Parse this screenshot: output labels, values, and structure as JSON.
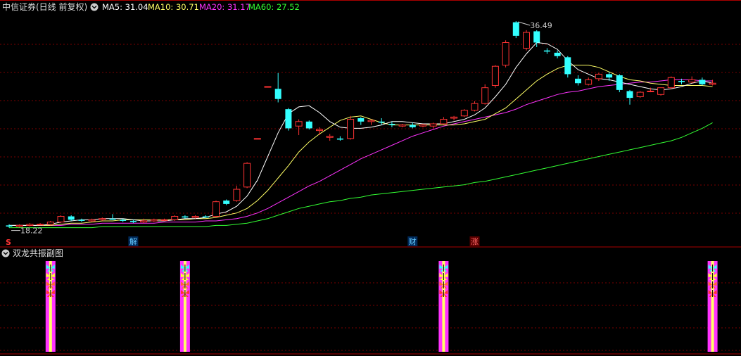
{
  "main_panel": {
    "title": "中信证券(日线 前复权)",
    "indicators": [
      {
        "label": "MA5: 31.04",
        "color": "#ffffff"
      },
      {
        "label": "MA10: 30.71",
        "color": "#ffff66"
      },
      {
        "label": "MA20: 31.17",
        "color": "#ff33ff"
      },
      {
        "label": "MA60: 27.52",
        "color": "#33ff33"
      }
    ],
    "high_label": "36.49",
    "low_label": "18.22",
    "markers": [
      {
        "text": "解",
        "index": 12,
        "kind": "tag"
      },
      {
        "text": "财",
        "index": 39,
        "kind": "tag"
      },
      {
        "text": "涨",
        "index": 45,
        "kind": "tag"
      },
      {
        "text": "S",
        "index": 0,
        "kind": "signal"
      }
    ]
  },
  "sub_panel": {
    "title": "双龙共振副图",
    "signal_indices": [
      4,
      17,
      42,
      68
    ],
    "icon": "butterfly-icon"
  },
  "colors": {
    "up": "#ff3333",
    "down": "#33ffff",
    "ma5": "#ffffff",
    "ma10": "#ffff66",
    "ma20": "#ff33ff",
    "ma60": "#33ff33",
    "grid": "#7a0000",
    "panel_border": "#aa0000",
    "signal_bar": "#ff33ff",
    "signal_core": "#ffff66"
  },
  "chart_data": {
    "type": "candlestick",
    "y_range": [
      17.8,
      37.0
    ],
    "x_count": 69,
    "ohlc": [
      [
        18.4,
        18.5,
        18.2,
        18.3
      ],
      [
        18.3,
        18.5,
        18.2,
        18.4
      ],
      [
        18.4,
        18.6,
        18.3,
        18.5
      ],
      [
        18.5,
        18.6,
        18.4,
        18.5
      ],
      [
        18.5,
        18.8,
        18.4,
        18.7
      ],
      [
        18.7,
        19.3,
        18.6,
        19.2
      ],
      [
        19.2,
        19.3,
        18.8,
        18.9
      ],
      [
        18.9,
        19.0,
        18.7,
        18.8
      ],
      [
        18.8,
        19.0,
        18.7,
        18.9
      ],
      [
        18.9,
        19.1,
        18.8,
        19.0
      ],
      [
        19.0,
        19.4,
        18.9,
        18.9
      ],
      [
        18.9,
        19.0,
        18.7,
        18.8
      ],
      [
        18.8,
        18.9,
        18.6,
        18.7
      ],
      [
        18.7,
        19.0,
        18.6,
        18.8
      ],
      [
        18.8,
        19.0,
        18.7,
        18.9
      ],
      [
        18.9,
        19.0,
        18.8,
        18.9
      ],
      [
        18.9,
        19.3,
        18.8,
        19.2
      ],
      [
        19.2,
        19.3,
        19.0,
        19.1
      ],
      [
        19.1,
        19.3,
        19.0,
        19.2
      ],
      [
        19.2,
        19.3,
        19.1,
        19.1
      ],
      [
        19.2,
        20.6,
        19.1,
        20.5
      ],
      [
        20.6,
        20.7,
        20.2,
        20.3
      ],
      [
        20.6,
        21.9,
        20.5,
        21.6
      ],
      [
        21.8,
        24.0,
        21.7,
        23.9
      ],
      [
        26.1,
        26.1,
        26.1,
        26.1
      ],
      [
        30.7,
        30.7,
        30.7,
        30.7
      ],
      [
        30.5,
        31.9,
        29.3,
        29.6
      ],
      [
        28.7,
        28.8,
        26.8,
        27.0
      ],
      [
        27.2,
        27.8,
        26.4,
        27.6
      ],
      [
        27.6,
        27.7,
        26.9,
        27.0
      ],
      [
        26.8,
        27.1,
        26.4,
        26.9
      ],
      [
        26.2,
        26.5,
        25.9,
        26.3
      ],
      [
        26.1,
        26.3,
        25.9,
        26.0
      ],
      [
        26.1,
        28.1,
        26.0,
        27.8
      ],
      [
        27.9,
        28.0,
        27.3,
        27.6
      ],
      [
        27.6,
        27.8,
        27.3,
        27.7
      ],
      [
        27.6,
        27.9,
        27.3,
        27.5
      ],
      [
        27.4,
        27.6,
        27.1,
        27.3
      ],
      [
        27.2,
        27.4,
        27.1,
        27.3
      ],
      [
        27.3,
        27.5,
        27.0,
        27.1
      ],
      [
        27.2,
        27.4,
        27.1,
        27.3
      ],
      [
        27.2,
        27.5,
        27.0,
        27.4
      ],
      [
        27.4,
        28.0,
        27.3,
        27.8
      ],
      [
        27.9,
        28.1,
        27.7,
        28.0
      ],
      [
        28.1,
        28.7,
        28.0,
        28.6
      ],
      [
        28.6,
        29.4,
        28.5,
        29.2
      ],
      [
        29.2,
        30.9,
        29.1,
        30.6
      ],
      [
        30.8,
        32.6,
        30.6,
        32.5
      ],
      [
        32.6,
        34.8,
        32.4,
        34.6
      ],
      [
        36.4,
        36.5,
        35.0,
        35.2
      ],
      [
        34.1,
        35.7,
        33.9,
        35.5
      ],
      [
        35.6,
        35.7,
        34.2,
        34.6
      ],
      [
        33.9,
        34.1,
        33.6,
        33.8
      ],
      [
        33.7,
        33.9,
        33.2,
        33.4
      ],
      [
        33.3,
        33.4,
        31.5,
        31.8
      ],
      [
        31.4,
        31.7,
        30.8,
        31.0
      ],
      [
        30.9,
        31.5,
        30.8,
        31.3
      ],
      [
        31.4,
        31.9,
        31.2,
        31.8
      ],
      [
        31.8,
        32.0,
        31.2,
        31.5
      ],
      [
        31.7,
        31.8,
        30.2,
        30.4
      ],
      [
        30.3,
        30.4,
        29.1,
        29.7
      ],
      [
        29.8,
        30.3,
        29.7,
        30.2
      ],
      [
        30.3,
        30.6,
        30.2,
        30.3
      ],
      [
        30.0,
        30.6,
        29.9,
        30.6
      ],
      [
        30.6,
        31.6,
        30.5,
        31.5
      ],
      [
        31.2,
        31.4,
        30.9,
        31.1
      ],
      [
        31.1,
        31.6,
        31.0,
        31.3
      ],
      [
        31.3,
        31.5,
        30.8,
        30.9
      ],
      [
        30.9,
        31.3,
        30.8,
        31.0
      ]
    ],
    "ma5": [
      18.4,
      18.4,
      18.4,
      18.4,
      18.5,
      18.7,
      18.8,
      18.9,
      18.9,
      19.0,
      19.0,
      19.0,
      18.9,
      18.8,
      18.8,
      18.8,
      18.9,
      19.0,
      19.0,
      19.1,
      19.4,
      19.6,
      20.1,
      21.0,
      22.4,
      24.5,
      26.6,
      28.3,
      28.9,
      29.0,
      28.4,
      27.6,
      27.1,
      27.0,
      27.0,
      27.1,
      27.3,
      27.6,
      27.6,
      27.5,
      27.4,
      27.4,
      27.4,
      27.6,
      27.8,
      28.2,
      28.8,
      29.8,
      30.9,
      32.4,
      33.6,
      34.6,
      34.5,
      34.0,
      33.0,
      32.2,
      31.8,
      31.4,
      31.3,
      31.1,
      30.9,
      30.7,
      30.5,
      30.4,
      30.5,
      30.7,
      31.0,
      31.2,
      31.0
    ],
    "ma10": [
      18.4,
      18.4,
      18.4,
      18.4,
      18.4,
      18.5,
      18.6,
      18.6,
      18.7,
      18.8,
      18.8,
      18.9,
      18.9,
      18.9,
      18.9,
      18.9,
      18.9,
      18.9,
      19.0,
      19.0,
      19.1,
      19.3,
      19.5,
      19.9,
      20.6,
      21.5,
      22.6,
      23.7,
      24.9,
      25.8,
      26.5,
      27.1,
      27.7,
      28.0,
      28.1,
      27.8,
      27.5,
      27.3,
      27.3,
      27.3,
      27.3,
      27.3,
      27.3,
      27.3,
      27.4,
      27.6,
      27.8,
      28.3,
      28.8,
      29.6,
      30.4,
      31.2,
      31.8,
      32.3,
      32.6,
      32.6,
      32.6,
      32.4,
      32.0,
      31.6,
      31.3,
      31.2,
      31.0,
      30.9,
      30.8,
      30.8,
      30.8,
      30.8,
      30.7
    ],
    "ma20": [
      18.4,
      18.4,
      18.4,
      18.4,
      18.4,
      18.4,
      18.5,
      18.5,
      18.5,
      18.6,
      18.6,
      18.6,
      18.6,
      18.6,
      18.6,
      18.7,
      18.7,
      18.7,
      18.7,
      18.8,
      18.8,
      18.9,
      19.0,
      19.2,
      19.5,
      19.9,
      20.4,
      20.9,
      21.4,
      21.9,
      22.3,
      22.8,
      23.3,
      23.8,
      24.3,
      24.7,
      25.1,
      25.5,
      25.9,
      26.3,
      26.6,
      26.9,
      27.2,
      27.4,
      27.6,
      27.8,
      28.0,
      28.2,
      28.4,
      28.7,
      29.1,
      29.4,
      29.7,
      30.0,
      30.2,
      30.3,
      30.5,
      30.7,
      30.8,
      30.9,
      31.0,
      31.1,
      31.1,
      31.2,
      31.3,
      31.3,
      31.3,
      31.2,
      31.2
    ],
    "ma60": [
      18.2,
      18.2,
      18.2,
      18.2,
      18.2,
      18.2,
      18.2,
      18.2,
      18.2,
      18.3,
      18.3,
      18.3,
      18.3,
      18.3,
      18.3,
      18.3,
      18.3,
      18.3,
      18.3,
      18.3,
      18.4,
      18.4,
      18.5,
      18.6,
      18.8,
      19.0,
      19.3,
      19.6,
      19.9,
      20.1,
      20.3,
      20.5,
      20.6,
      20.8,
      20.9,
      21.1,
      21.2,
      21.3,
      21.4,
      21.5,
      21.6,
      21.7,
      21.8,
      21.9,
      22.0,
      22.2,
      22.3,
      22.5,
      22.7,
      22.9,
      23.1,
      23.3,
      23.5,
      23.7,
      23.9,
      24.1,
      24.3,
      24.5,
      24.7,
      24.9,
      25.1,
      25.3,
      25.5,
      25.7,
      25.9,
      26.2,
      26.6,
      27.0,
      27.5
    ]
  }
}
